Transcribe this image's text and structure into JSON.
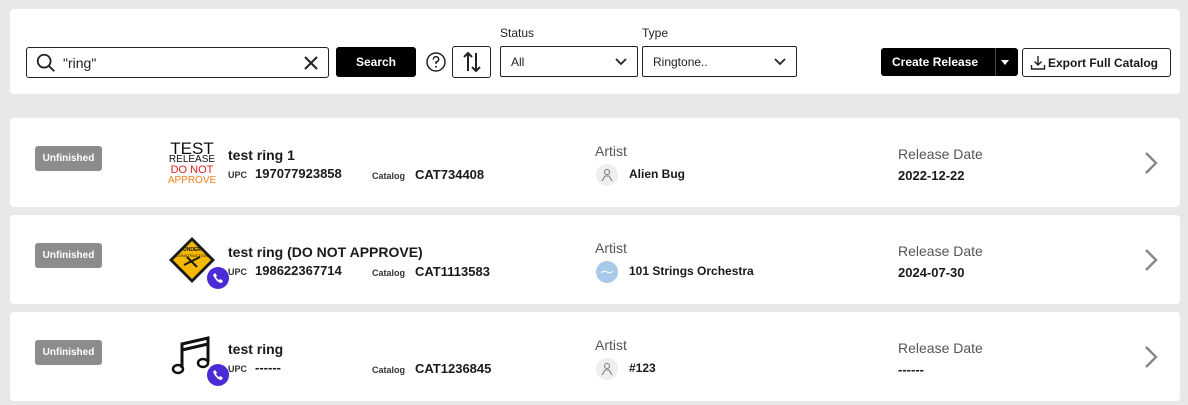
{
  "search": {
    "value": "\"ring\"",
    "button_label": "Search"
  },
  "filters": {
    "status_label": "Status",
    "status_value": "All",
    "type_label": "Type",
    "type_value": "Ringtone.."
  },
  "actions": {
    "create_label": "Create Release",
    "export_label": "Export Full Catalog"
  },
  "releases": [
    {
      "status": "Unfinished",
      "title": "test ring 1",
      "upc_label": "UPC",
      "upc": "197077923858",
      "catalog_label": "Catalog",
      "catalog": "CAT734408",
      "artist_label": "Artist",
      "artist": "Alien Bug",
      "date_label": "Release Date",
      "date": "2022-12-22",
      "artwork_text": [
        "TEST",
        "RELEASE",
        "DO NOT",
        "APPROVE"
      ]
    },
    {
      "status": "Unfinished",
      "title": "test ring (DO NOT APPROVE)",
      "upc_label": "UPC",
      "upc": "198622367714",
      "catalog_label": "Catalog",
      "catalog": "CAT1113583",
      "artist_label": "Artist",
      "artist": "101 Strings Orchestra",
      "date_label": "Release Date",
      "date": "2024-07-30",
      "artwork_text": [
        "UNDER",
        "CONSTRUCTION"
      ]
    },
    {
      "status": "Unfinished",
      "title": "test ring",
      "upc_label": "UPC",
      "upc": "------",
      "catalog_label": "Catalog",
      "catalog": "CAT1236845",
      "artist_label": "Artist",
      "artist": "#123",
      "date_label": "Release Date",
      "date": "------"
    }
  ],
  "colors": {
    "accent_phone": "#4a2bd6",
    "badge": "#8c8c8c",
    "primary": "#000000"
  }
}
